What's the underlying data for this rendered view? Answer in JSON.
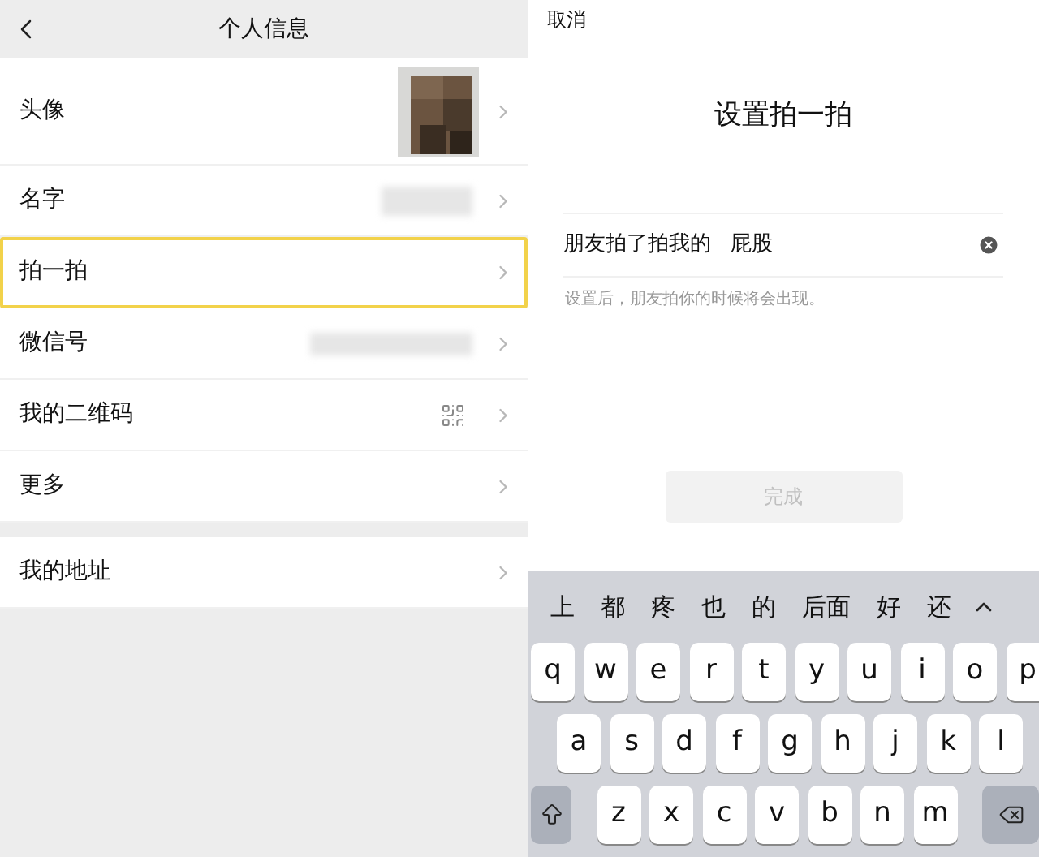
{
  "left": {
    "header": {
      "title": "个人信息"
    },
    "sections": [
      {
        "rows": [
          {
            "label": "头像",
            "kind": "avatar",
            "highlighted": false
          },
          {
            "label": "名字",
            "kind": "blurred",
            "highlighted": false
          },
          {
            "label": "拍一拍",
            "kind": "plain",
            "highlighted": true
          },
          {
            "label": "微信号",
            "kind": "blurred_wide",
            "highlighted": false
          },
          {
            "label": "我的二维码",
            "kind": "qr",
            "highlighted": false
          },
          {
            "label": "更多",
            "kind": "plain",
            "highlighted": false
          }
        ]
      },
      {
        "rows": [
          {
            "label": "我的地址",
            "kind": "plain",
            "highlighted": false
          }
        ]
      }
    ]
  },
  "right": {
    "cancel": "取消",
    "title": "设置拍一拍",
    "field": {
      "prefix": "朋友拍了拍我的",
      "value": "屁股"
    },
    "hint": "设置后，朋友拍你的时候将会出现。",
    "done_button": {
      "label": "完成",
      "disabled": true
    },
    "keyboard": {
      "candidates": [
        "上",
        "都",
        "疼",
        "也",
        "的",
        "后面",
        "好",
        "还"
      ],
      "rows": [
        [
          "q",
          "w",
          "e",
          "r",
          "t",
          "y",
          "u",
          "i",
          "o",
          "p"
        ],
        [
          "a",
          "s",
          "d",
          "f",
          "g",
          "h",
          "j",
          "k",
          "l"
        ],
        [
          "z",
          "x",
          "c",
          "v",
          "b",
          "n",
          "m"
        ]
      ]
    }
  }
}
